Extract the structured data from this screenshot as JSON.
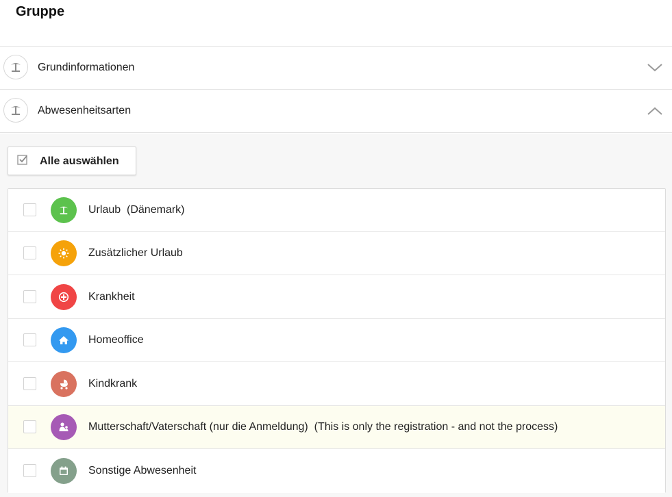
{
  "page": {
    "title": "Gruppe"
  },
  "sections": [
    {
      "label": "Grundinformationen",
      "icon": "palm-tree-icon",
      "state": "collapsed"
    },
    {
      "label": "Abwesenheitsarten",
      "icon": "palm-tree-icon",
      "state": "expanded"
    }
  ],
  "select_all": {
    "label": "Alle auswählen",
    "icon": "checkbox-checked-icon"
  },
  "absence_types": [
    {
      "label": "Urlaub  (Dänemark)",
      "icon": "palm-tree-icon",
      "color": "#5cc24d",
      "checked": false
    },
    {
      "label": "Zusätzlicher Urlaub",
      "icon": "sun-icon",
      "color": "#f5a20a",
      "checked": false
    },
    {
      "label": "Krankheit",
      "icon": "medical-cross-icon",
      "color": "#f04545",
      "checked": false
    },
    {
      "label": "Homeoffice",
      "icon": "home-icon",
      "color": "#3399f0",
      "checked": false
    },
    {
      "label": "Kindkrank",
      "icon": "stroller-icon",
      "color": "#d9725f",
      "checked": false
    },
    {
      "label": "Mutterschaft/Vaterschaft (nur die Anmeldung)  (This is only the registration - and not the process)",
      "icon": "parent-child-icon",
      "color": "#a65ab5",
      "checked": false,
      "highlighted": true
    },
    {
      "label": "Sonstige Abwesenheit",
      "icon": "calendar-icon",
      "color": "#84a08b",
      "checked": false
    }
  ]
}
